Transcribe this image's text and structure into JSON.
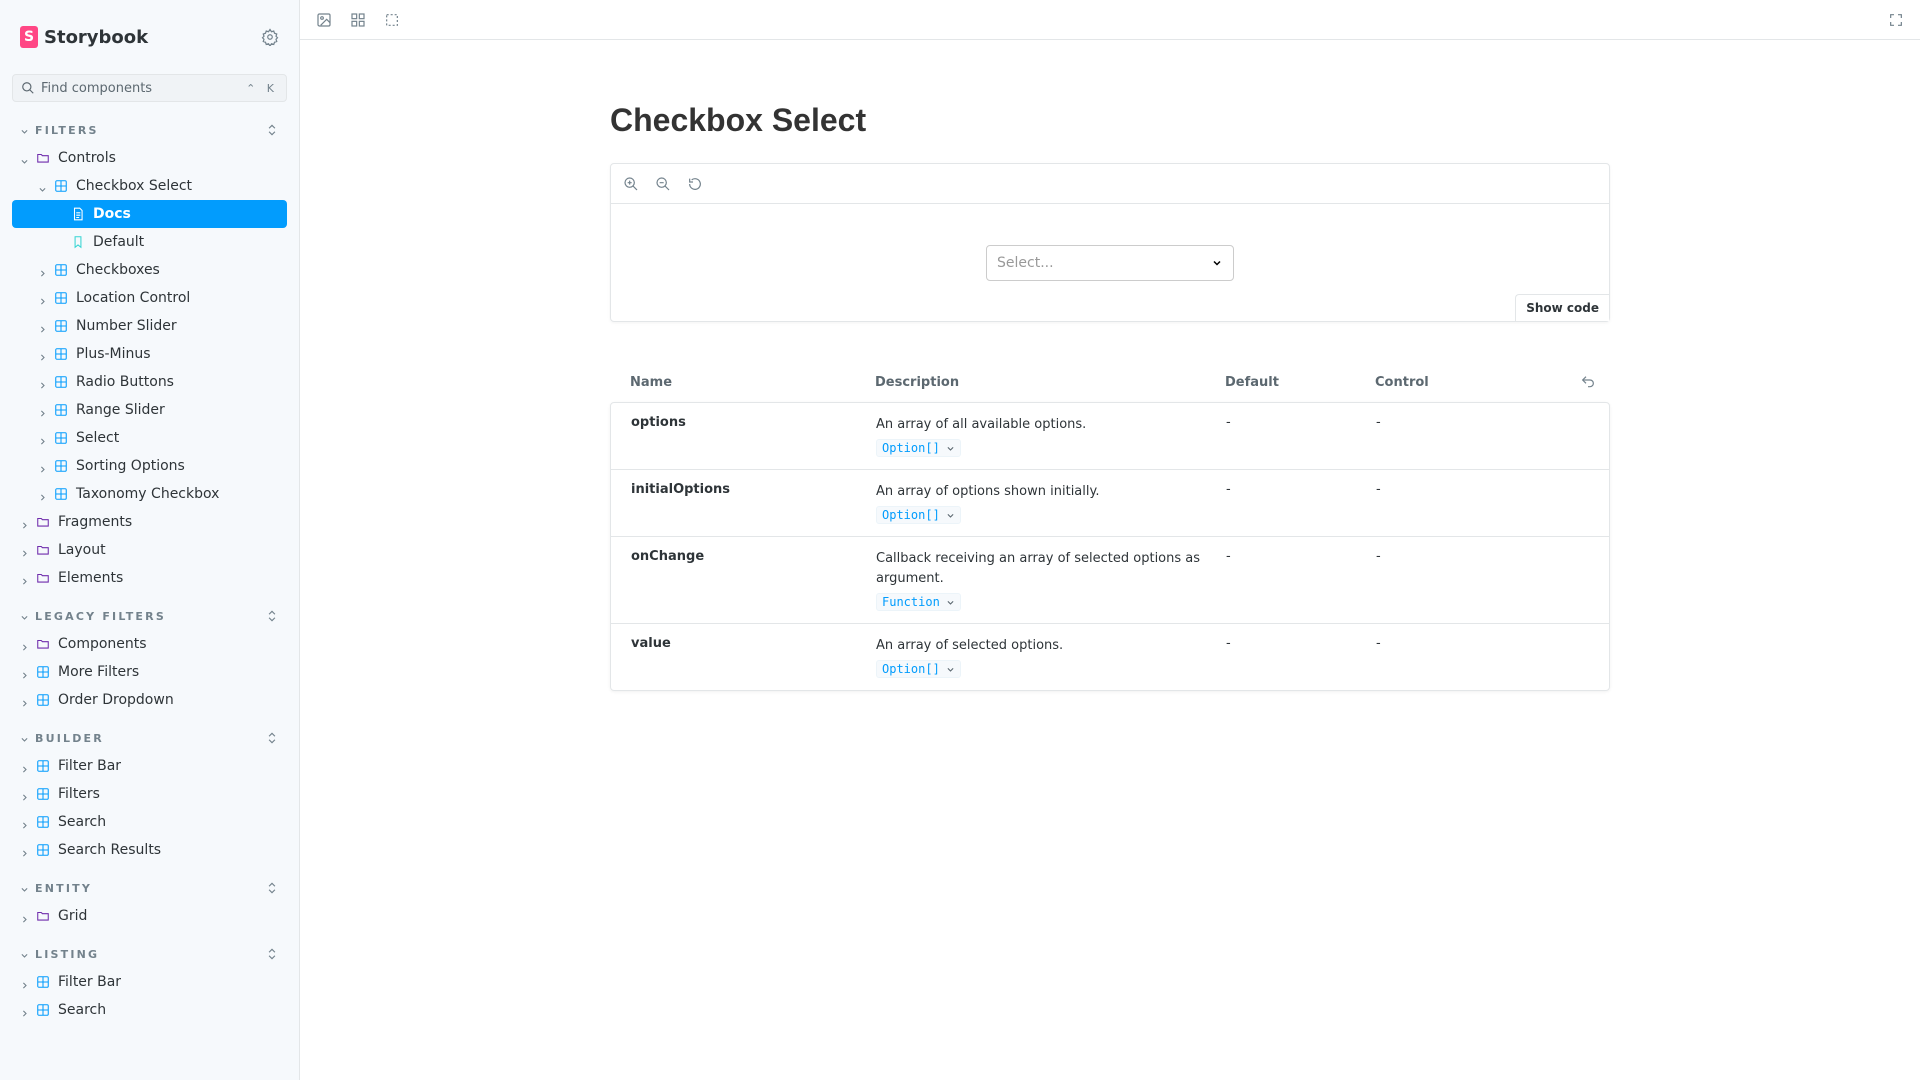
{
  "brand": {
    "name": "Storybook",
    "logo_letter": "S"
  },
  "search": {
    "placeholder": "Find components",
    "shortcut": "⌃ K"
  },
  "sidebar": {
    "sections": [
      {
        "title": "FILTERS",
        "items": [
          {
            "label": "Controls",
            "icon": "folder-icon",
            "level": 0,
            "expanded": true
          },
          {
            "label": "Checkbox Select",
            "icon": "component-icon",
            "level": 1,
            "expanded": true
          },
          {
            "label": "Docs",
            "icon": "document-icon",
            "level": 2,
            "active": true
          },
          {
            "label": "Default",
            "icon": "bookmark-icon",
            "level": 2
          },
          {
            "label": "Checkboxes",
            "icon": "component-icon",
            "level": 1
          },
          {
            "label": "Location Control",
            "icon": "component-icon",
            "level": 1
          },
          {
            "label": "Number Slider",
            "icon": "component-icon",
            "level": 1
          },
          {
            "label": "Plus-Minus",
            "icon": "component-icon",
            "level": 1
          },
          {
            "label": "Radio Buttons",
            "icon": "component-icon",
            "level": 1
          },
          {
            "label": "Range Slider",
            "icon": "component-icon",
            "level": 1
          },
          {
            "label": "Select",
            "icon": "component-icon",
            "level": 1
          },
          {
            "label": "Sorting Options",
            "icon": "component-icon",
            "level": 1
          },
          {
            "label": "Taxonomy Checkbox",
            "icon": "component-icon",
            "level": 1
          },
          {
            "label": "Fragments",
            "icon": "folder-icon",
            "level": 0
          },
          {
            "label": "Layout",
            "icon": "folder-icon",
            "level": 0
          },
          {
            "label": "Elements",
            "icon": "folder-icon",
            "level": 0
          }
        ]
      },
      {
        "title": "LEGACY FILTERS",
        "items": [
          {
            "label": "Components",
            "icon": "folder-icon",
            "level": 0
          },
          {
            "label": "More Filters",
            "icon": "component-icon",
            "level": 0
          },
          {
            "label": "Order Dropdown",
            "icon": "component-icon",
            "level": 0
          }
        ]
      },
      {
        "title": "BUILDER",
        "items": [
          {
            "label": "Filter Bar",
            "icon": "component-icon",
            "level": 0
          },
          {
            "label": "Filters",
            "icon": "component-icon",
            "level": 0
          },
          {
            "label": "Search",
            "icon": "component-icon",
            "level": 0
          },
          {
            "label": "Search Results",
            "icon": "component-icon",
            "level": 0
          }
        ]
      },
      {
        "title": "ENTITY",
        "items": [
          {
            "label": "Grid",
            "icon": "folder-icon",
            "level": 0
          }
        ]
      },
      {
        "title": "LISTING",
        "items": [
          {
            "label": "Filter Bar",
            "icon": "component-icon",
            "level": 0
          },
          {
            "label": "Search",
            "icon": "component-icon",
            "level": 0
          }
        ]
      }
    ]
  },
  "page": {
    "title": "Checkbox Select",
    "select_placeholder": "Select...",
    "show_code": "Show code"
  },
  "args_table": {
    "headers": {
      "name": "Name",
      "description": "Description",
      "default": "Default",
      "control": "Control"
    },
    "rows": [
      {
        "name": "options",
        "description": "An array of all available options.",
        "type": "Option[]",
        "default": "-",
        "control": "-"
      },
      {
        "name": "initialOptions",
        "description": "An array of options shown initially.",
        "type": "Option[]",
        "default": "-",
        "control": "-"
      },
      {
        "name": "onChange",
        "description": "Callback receiving an array of selected options as argument.",
        "type": "Function",
        "default": "-",
        "control": "-"
      },
      {
        "name": "value",
        "description": "An array of selected options.",
        "type": "Option[]",
        "default": "-",
        "control": "-"
      }
    ]
  },
  "colors": {
    "accent": "#029cfd",
    "brand": "#ff4785",
    "folder": "#6f2cac",
    "story": "#37d5d3"
  }
}
